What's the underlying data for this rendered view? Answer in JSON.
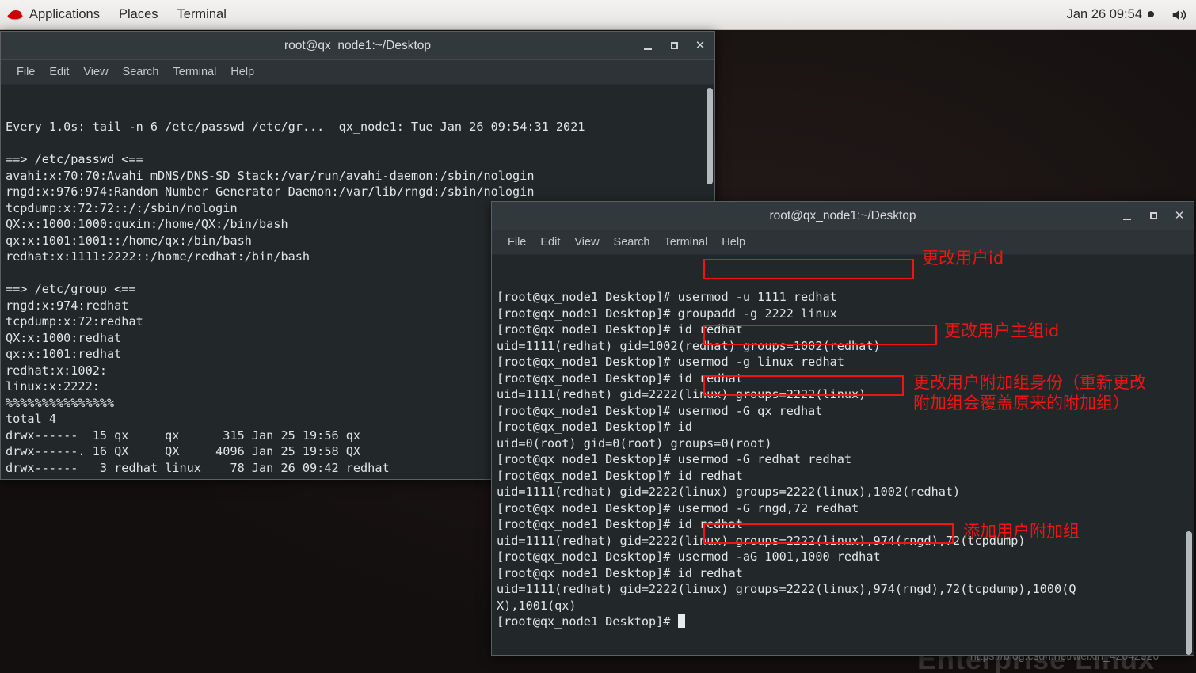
{
  "top_panel": {
    "logo_icon": "redhat-logo-icon",
    "items": [
      {
        "label": "Applications"
      },
      {
        "label": "Places"
      },
      {
        "label": "Terminal"
      }
    ],
    "clock": "Jan 26  09:54",
    "volume_icon": "volume-icon"
  },
  "desktop": {
    "wordmark": "Enterprise Linux",
    "watermark": "https://blog.csdn.net/weixin_42042926"
  },
  "window_one": {
    "title": "root@qx_node1:~/Desktop",
    "menu": [
      {
        "label": "File"
      },
      {
        "label": "Edit"
      },
      {
        "label": "View"
      },
      {
        "label": "Search"
      },
      {
        "label": "Terminal"
      },
      {
        "label": "Help"
      }
    ],
    "buttons": {
      "minimize": "minimize-button",
      "maximize": "maximize-button",
      "close": "close-button"
    },
    "content": "Every 1.0s: tail -n 6 /etc/passwd /etc/gr...  qx_node1: Tue Jan 26 09:54:31 2021\n\n==> /etc/passwd <==\navahi:x:70:70:Avahi mDNS/DNS-SD Stack:/var/run/avahi-daemon:/sbin/nologin\nrngd:x:976:974:Random Number Generator Daemon:/var/lib/rngd:/sbin/nologin\ntcpdump:x:72:72::/:/sbin/nologin\nQX:x:1000:1000:quxin:/home/QX:/bin/bash\nqx:x:1001:1001::/home/qx:/bin/bash\nredhat:x:1111:2222::/home/redhat:/bin/bash\n\n==> /etc/group <==\nrngd:x:974:redhat\ntcpdump:x:72:redhat\nQX:x:1000:redhat\nqx:x:1001:redhat\nredhat:x:1002:\nlinux:x:2222:\n%%%%%%%%%%%%%%%\ntotal 4\ndrwx------  15 qx     qx      315 Jan 25 19:56 qx\ndrwx------. 16 QX     QX     4096 Jan 25 19:58 QX\ndrwx------   3 redhat linux    78 Jan 26 09:42 redhat"
  },
  "window_two": {
    "title": "root@qx_node1:~/Desktop",
    "menu": [
      {
        "label": "File"
      },
      {
        "label": "Edit"
      },
      {
        "label": "View"
      },
      {
        "label": "Search"
      },
      {
        "label": "Terminal"
      },
      {
        "label": "Help"
      }
    ],
    "buttons": {
      "minimize": "minimize-button",
      "maximize": "maximize-button",
      "close": "close-button"
    },
    "content": "[root@qx_node1 Desktop]# usermod -u 1111 redhat\n[root@qx_node1 Desktop]# groupadd -g 2222 linux\n[root@qx_node1 Desktop]# id redhat\nuid=1111(redhat) gid=1002(redhat) groups=1002(redhat)\n[root@qx_node1 Desktop]# usermod -g linux redhat\n[root@qx_node1 Desktop]# id redhat\nuid=1111(redhat) gid=2222(linux) groups=2222(linux)\n[root@qx_node1 Desktop]# usermod -G qx redhat\n[root@qx_node1 Desktop]# id\nuid=0(root) gid=0(root) groups=0(root)\n[root@qx_node1 Desktop]# usermod -G redhat redhat\n[root@qx_node1 Desktop]# id redhat\nuid=1111(redhat) gid=2222(linux) groups=2222(linux),1002(redhat)\n[root@qx_node1 Desktop]# usermod -G rngd,72 redhat\n[root@qx_node1 Desktop]# id redhat\nuid=1111(redhat) gid=2222(linux) groups=2222(linux),974(rngd),72(tcpdump)\n[root@qx_node1 Desktop]# usermod -aG 1001,1000 redhat\n[root@qx_node1 Desktop]# id redhat\nuid=1111(redhat) gid=2222(linux) groups=2222(linux),974(rngd),72(tcpdump),1000(Q\nX),1001(qx)\n[root@qx_node1 Desktop]# ",
    "prompt_cursor": "cursor"
  },
  "annotations": {
    "color": "#f01414",
    "notes": [
      {
        "text": "更改用户id"
      },
      {
        "text": "更改用户主组id"
      },
      {
        "text": "更改用户附加组身份（重新更改\n附加组会覆盖原来的附加组）"
      },
      {
        "text": "添加用户附加组"
      }
    ],
    "highlight_boxes": [
      {
        "target": "usermod -u 1111 redhat"
      },
      {
        "target": "usermod -g linux redhat"
      },
      {
        "target": "usermod -G qx redhat"
      },
      {
        "target": "usermod -aG 1001,1000 redhat"
      }
    ]
  }
}
